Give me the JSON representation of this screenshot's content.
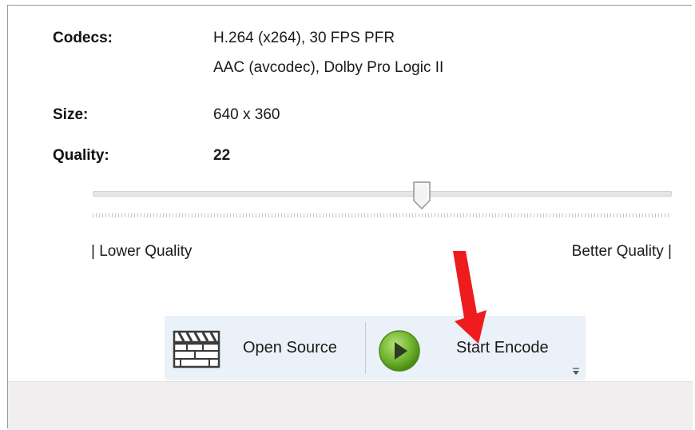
{
  "summary": {
    "codecs_label": "Codecs:",
    "codecs_video": "H.264 (x264), 30 FPS PFR",
    "codecs_audio": "AAC (avcodec), Dolby Pro Logic II",
    "size_label": "Size:",
    "size_value": "640 x 360",
    "quality_label": "Quality:",
    "quality_value": "22"
  },
  "quality_slider": {
    "level_fraction": 0.57,
    "lower_label": "| Lower Quality",
    "better_label": "Better Quality |"
  },
  "toolbar": {
    "open_source_label": "Open Source",
    "open_source_icon": "clapperboard-icon",
    "start_encode_label": "Start Encode",
    "start_encode_icon": "play-icon",
    "overflow_icon": "chevron-down-icon"
  },
  "annotation": {
    "arrow_color": "#ee1c1c"
  }
}
